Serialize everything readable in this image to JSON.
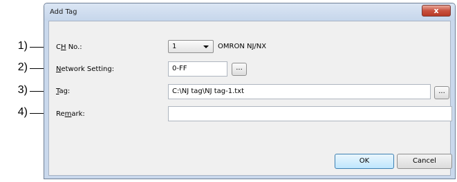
{
  "callouts": [
    "1)",
    "2)",
    "3)",
    "4)"
  ],
  "dialog": {
    "title": "Add Tag",
    "close_glyph": "x"
  },
  "fields": {
    "ch_no": {
      "label_pre": "C",
      "label_mnemonic": "H",
      "label_post": " No.:",
      "value": "1",
      "model": "OMRON NJ/NX"
    },
    "network_setting": {
      "label_pre": "",
      "label_mnemonic": "N",
      "label_post": "etwork Setting:",
      "value": "0-FF",
      "browse": "..."
    },
    "tag": {
      "label_pre": "",
      "label_mnemonic": "T",
      "label_post": "ag:",
      "value": "C:\\NJ tag\\NJ tag-1.txt",
      "browse": "..."
    },
    "remark": {
      "label_pre": "Re",
      "label_mnemonic": "m",
      "label_post": "ark:",
      "value": ""
    }
  },
  "buttons": {
    "ok": "OK",
    "cancel": "Cancel"
  }
}
